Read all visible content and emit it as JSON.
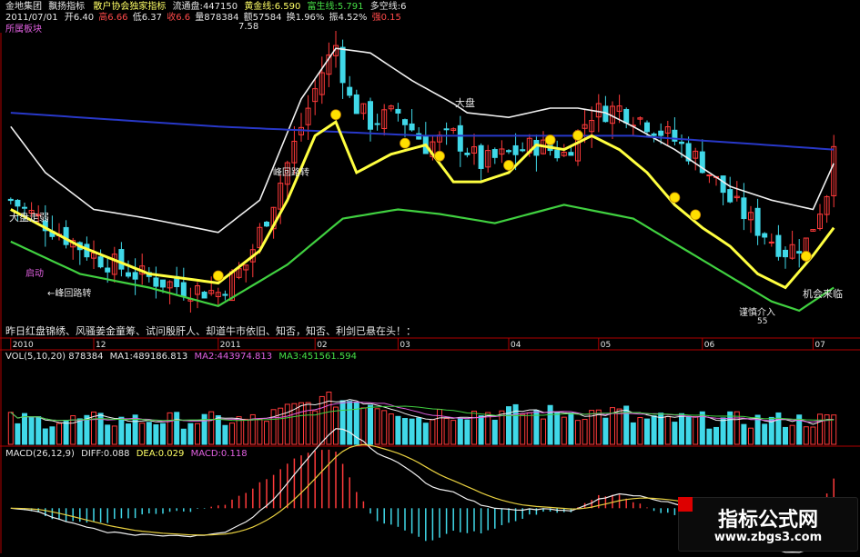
{
  "header": {
    "stock_name": "金地集团",
    "indicator": "飘扬指标",
    "note": "散户协会独家指标",
    "float_label": "流通盘:",
    "float_value": "447150",
    "gold_label": "黄金线:",
    "gold_value": "6.590",
    "life_label": "富生线:",
    "life_value": "5.791",
    "multi_label": "多空线:",
    "multi_value": "6",
    "date": "2011/07/01",
    "open_label": "开",
    "open_value": "6.40",
    "high_label": "高",
    "high_value": "6.66",
    "low_label": "低",
    "low_value": "6.37",
    "close_label": "收",
    "close_value": "6.6",
    "vol_label": "量",
    "vol_value": "878384",
    "amount_label": "额",
    "amount_value": "57584",
    "turnover_label": "换",
    "turnover_value": "1.96%",
    "amplitude_label": "振",
    "amplitude_value": "4.52%",
    "strength_label": "强",
    "strength_value": "0.15",
    "sector": "所属板块"
  },
  "annotations": {
    "peak": "7.58",
    "weak_market": "大盘走弱",
    "big_market": "大盘",
    "reverse": "←峰回路转",
    "reverse2": "峰回路转",
    "start": "启动",
    "opportunity": "机会来临",
    "cautious": "谨慎介入",
    "low_mark": "55",
    "poem": "昨日红盘锦绣、风骚姜金童筹、试问殷肝人、却道牛市依旧、知否，知否、利剑已悬在头！："
  },
  "time_axis": [
    "2010",
    "12",
    "2011",
    "02",
    "03",
    "04",
    "05",
    "06",
    "07"
  ],
  "volume_header": {
    "prefix": "VOL(5,10,20)",
    "vol": "878384",
    "ma1": "MA1:489186.813",
    "ma2": "MA2:443974.813",
    "ma3": "MA3:451561.594"
  },
  "macd_header": {
    "prefix": "MACD(26,12,9)",
    "diff": "DIFF:0.088",
    "dea": "DEA:0.029",
    "macd": "MACD:0.118"
  },
  "watermark": {
    "title": "指标公式网",
    "url": "www.zbgs3.com"
  },
  "colors": {
    "up": "#ff3a3a",
    "down": "#40d8e8",
    "ma_yellow": "#ffff40",
    "ma_white": "#f0f0f0",
    "ma_blue": "#2838c8",
    "ma_green": "#40d040",
    "smiley": "#ffe000"
  },
  "chart_data": {
    "type": "candlestick",
    "count": 120,
    "close_key_points": [
      [
        0,
        5.9
      ],
      [
        6,
        5.6
      ],
      [
        12,
        5.3
      ],
      [
        18,
        5.1
      ],
      [
        25,
        4.95
      ],
      [
        30,
        4.9
      ],
      [
        34,
        5.2
      ],
      [
        38,
        5.9
      ],
      [
        42,
        6.7
      ],
      [
        45,
        7.3
      ],
      [
        47,
        7.58
      ],
      [
        49,
        7.0
      ],
      [
        52,
        6.75
      ],
      [
        56,
        6.85
      ],
      [
        60,
        6.5
      ],
      [
        64,
        6.6
      ],
      [
        68,
        6.3
      ],
      [
        72,
        6.4
      ],
      [
        76,
        6.5
      ],
      [
        80,
        6.4
      ],
      [
        84,
        6.85
      ],
      [
        88,
        6.9
      ],
      [
        92,
        6.75
      ],
      [
        96,
        6.55
      ],
      [
        100,
        6.3
      ],
      [
        104,
        5.9
      ],
      [
        108,
        5.6
      ],
      [
        112,
        5.35
      ],
      [
        115,
        5.45
      ],
      [
        118,
        6.0
      ],
      [
        119,
        6.6
      ]
    ],
    "yellow_line_key": [
      [
        0,
        5.8
      ],
      [
        10,
        5.4
      ],
      [
        20,
        5.1
      ],
      [
        30,
        5.0
      ],
      [
        36,
        5.35
      ],
      [
        40,
        5.9
      ],
      [
        44,
        6.6
      ],
      [
        47,
        6.75
      ],
      [
        50,
        6.2
      ],
      [
        55,
        6.4
      ],
      [
        60,
        6.5
      ],
      [
        64,
        6.1
      ],
      [
        68,
        6.1
      ],
      [
        72,
        6.2
      ],
      [
        76,
        6.5
      ],
      [
        80,
        6.45
      ],
      [
        84,
        6.6
      ],
      [
        88,
        6.45
      ],
      [
        92,
        6.2
      ],
      [
        96,
        5.85
      ],
      [
        100,
        5.6
      ],
      [
        104,
        5.4
      ],
      [
        108,
        5.1
      ],
      [
        112,
        4.95
      ],
      [
        116,
        5.3
      ],
      [
        119,
        5.6
      ]
    ],
    "white_line_key": [
      [
        0,
        6.7
      ],
      [
        5,
        6.2
      ],
      [
        12,
        5.8
      ],
      [
        20,
        5.7
      ],
      [
        30,
        5.55
      ],
      [
        36,
        5.9
      ],
      [
        42,
        7.0
      ],
      [
        47,
        7.55
      ],
      [
        52,
        7.5
      ],
      [
        58,
        7.2
      ],
      [
        64,
        6.95
      ],
      [
        66,
        6.85
      ],
      [
        72,
        6.8
      ],
      [
        78,
        6.9
      ],
      [
        82,
        6.9
      ],
      [
        86,
        6.85
      ],
      [
        90,
        6.7
      ],
      [
        96,
        6.45
      ],
      [
        104,
        6.05
      ],
      [
        110,
        5.9
      ],
      [
        116,
        5.8
      ],
      [
        119,
        6.3
      ]
    ],
    "blue_line_key": [
      [
        0,
        6.85
      ],
      [
        30,
        6.7
      ],
      [
        60,
        6.6
      ],
      [
        90,
        6.6
      ],
      [
        119,
        6.45
      ]
    ],
    "green_line_key": [
      [
        0,
        5.45
      ],
      [
        10,
        5.1
      ],
      [
        20,
        4.95
      ],
      [
        30,
        4.75
      ],
      [
        40,
        5.2
      ],
      [
        48,
        5.7
      ],
      [
        56,
        5.8
      ],
      [
        62,
        5.75
      ],
      [
        70,
        5.65
      ],
      [
        80,
        5.85
      ],
      [
        90,
        5.7
      ],
      [
        100,
        5.25
      ],
      [
        110,
        4.8
      ],
      [
        114,
        4.7
      ],
      [
        119,
        4.95
      ]
    ],
    "price_range": [
      4.6,
      7.7
    ],
    "volume_range": [
      0,
      1600000
    ],
    "macd_range": [
      -0.3,
      0.35
    ]
  }
}
